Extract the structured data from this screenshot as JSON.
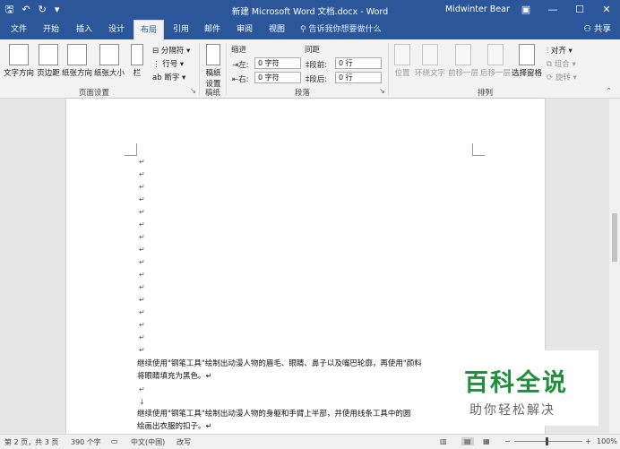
{
  "window": {
    "title": "新建 Microsoft Word 文档.docx - Word",
    "user": "Midwinter Bear",
    "qat_icons": [
      "save-icon",
      "undo-icon",
      "redo-icon",
      "customize-icon"
    ],
    "controls": [
      "ribbon-display-icon",
      "minimize-icon",
      "maximize-icon",
      "close-icon"
    ]
  },
  "tabs": [
    "文件",
    "开始",
    "插入",
    "设计",
    "布局",
    "引用",
    "邮件",
    "审阅",
    "视图"
  ],
  "active_tab": "布局",
  "tell_me": "告诉我你想要做什么",
  "share": "共享",
  "ribbon": {
    "page_setup": {
      "text_direction": "文字方向",
      "margins": "页边距",
      "orientation": "纸张方向",
      "size": "纸张大小",
      "columns": "栏",
      "breaks": "分隔符",
      "line_numbers": "行号",
      "hyphenation": "断字",
      "group_label": "页面设置"
    },
    "draft": {
      "button": "稿纸设置",
      "group_label": "稿纸"
    },
    "paragraph": {
      "indent_label": "缩进",
      "spacing_label": "间距",
      "left_label": "左:",
      "left_value": "0 字符",
      "right_label": "右:",
      "right_value": "0 字符",
      "before_label": "段前:",
      "before_value": "0 行",
      "after_label": "段后:",
      "after_value": "0 行",
      "group_label": "段落"
    },
    "arrange": {
      "position": "位置",
      "wrap_text": "环绕文字",
      "bring_forward": "前移一层",
      "send_backward": "后移一层",
      "selection_pane": "选择窗格",
      "align": "对齐",
      "group": "组合",
      "rotate": "旋转",
      "group_label": "排列"
    }
  },
  "document": {
    "paragraph_mark": "↵",
    "line_break_mark": "↓",
    "para1_line1": "继续使用\"钢笔工具\"绘制出动漫人物的眉毛、眼睛、鼻子以及嘴巴轮廓，再使用\"颜料",
    "para1_line2": "将眼睛填充为黑色。↵",
    "para2_line1": "继续使用\"钢笔工具\"绘制出动漫人物的身躯和手臂上半部，并使用线条工具中的圆",
    "para2_line2": "绘画出衣服的扣子。↵"
  },
  "status": {
    "page": "第 2 页，共 3 页",
    "words": "390 个字",
    "language": "中文(中国)",
    "mode": "改写",
    "zoom": "100%"
  },
  "watermark": {
    "line1": "百科全说",
    "line2": "助你轻松解决"
  }
}
